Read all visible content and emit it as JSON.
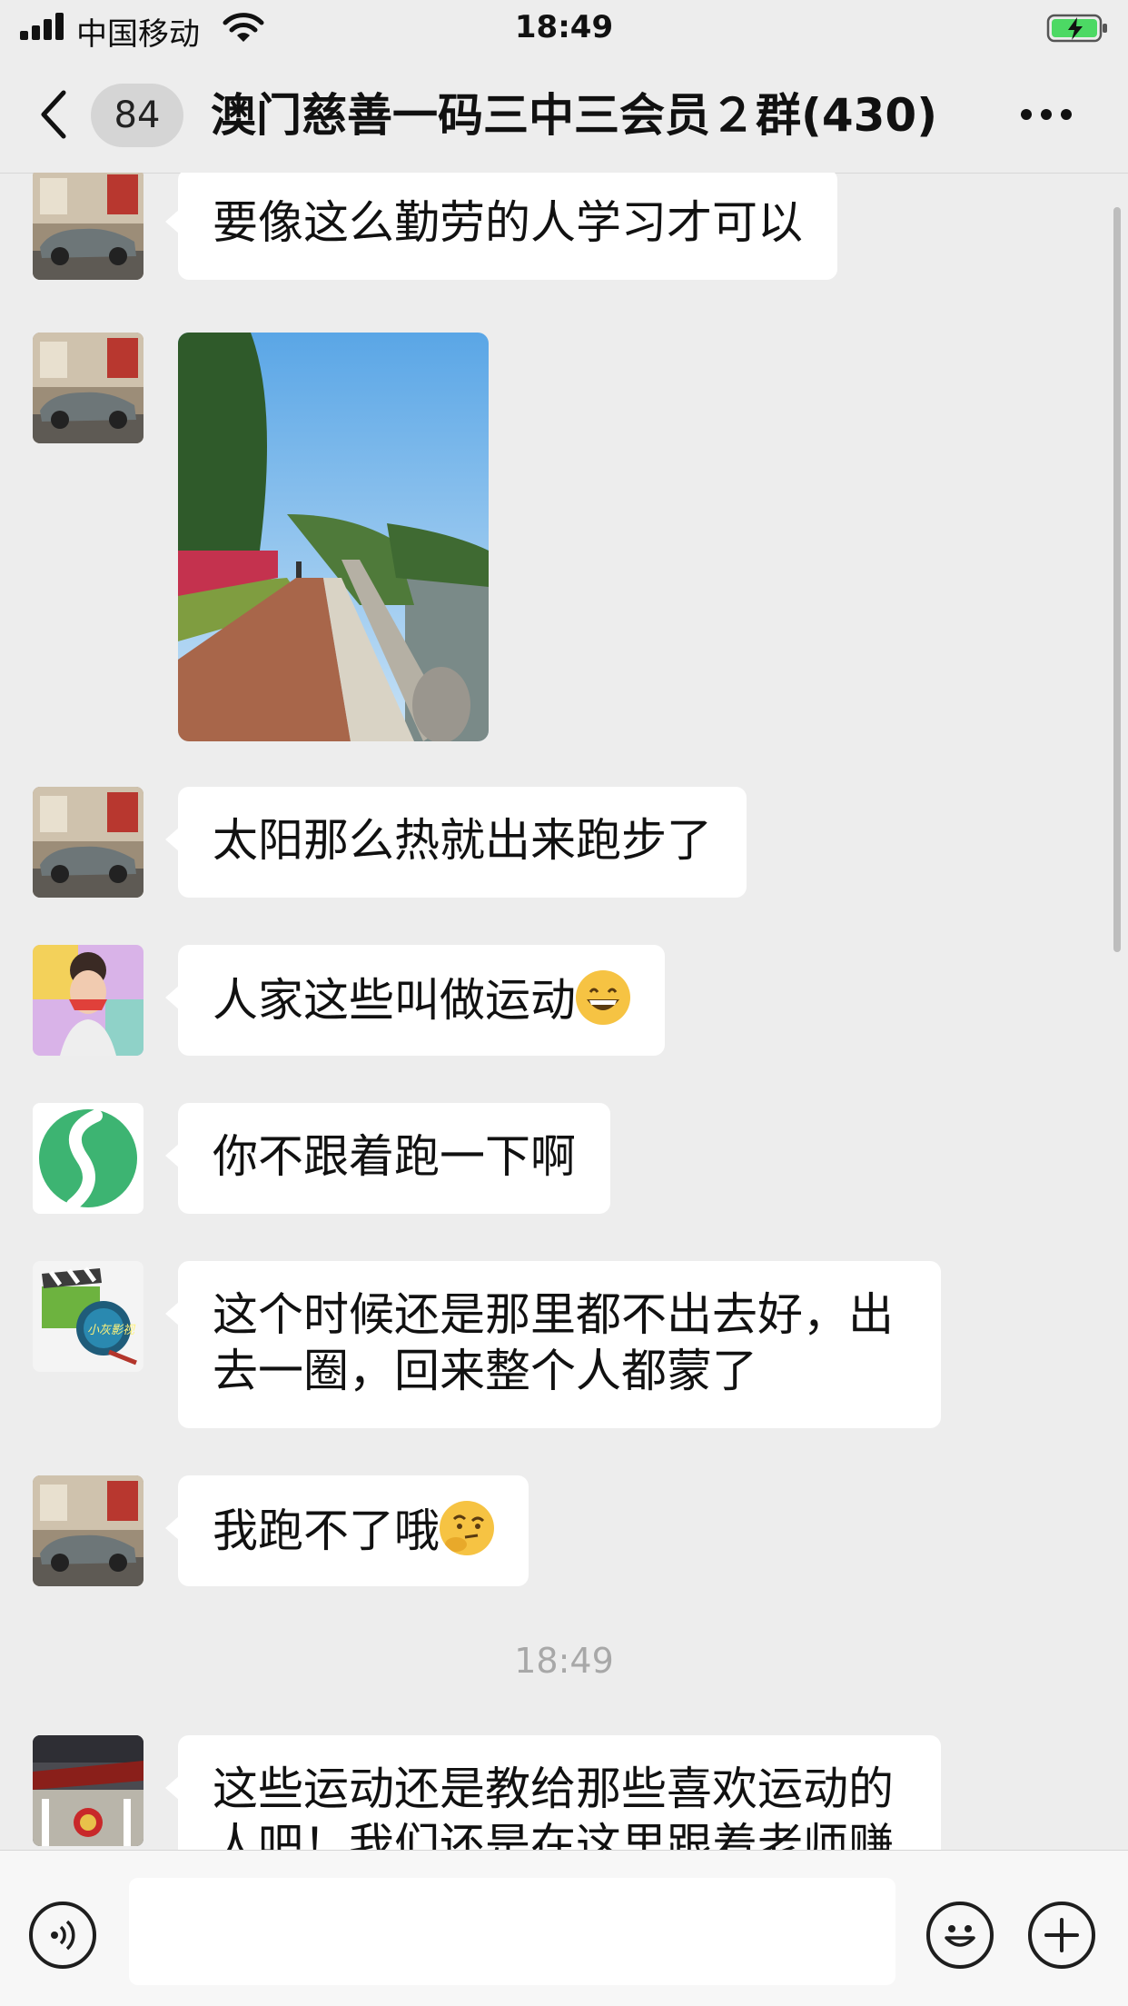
{
  "status_bar": {
    "carrier": "中国移动",
    "time": "18:49"
  },
  "nav": {
    "unread_count": "84",
    "title": "澳门慈善一码三中三会员２群(430)"
  },
  "messages": [
    {
      "type": "text",
      "avatar": "car-avatar",
      "text": "要像这么勤劳的人学习才可以"
    },
    {
      "type": "image",
      "avatar": "car-avatar"
    },
    {
      "type": "text",
      "avatar": "car-avatar",
      "text": "太阳那么热就出来跑步了"
    },
    {
      "type": "text",
      "avatar": "girl-avatar",
      "text": "人家这些叫做运动",
      "emoji": "grinning-sweat-emoji"
    },
    {
      "type": "text",
      "avatar": "green-logo-avatar",
      "text": "你不跟着跑一下啊"
    },
    {
      "type": "text",
      "avatar": "film-avatar",
      "avatar_caption": "小灰影视",
      "text": "这个时候还是那里都不出去好，出去一圈，回来整个人都蒙了"
    },
    {
      "type": "text",
      "avatar": "car-avatar",
      "text": "我跑不了哦",
      "emoji": "thinking-face-emoji"
    },
    {
      "type": "time",
      "text": "18:49"
    },
    {
      "type": "text",
      "avatar": "building-avatar",
      "text": "这些运动还是教给那些喜欢运动的人吧！我们还是在这里跟着老师赚"
    }
  ],
  "input_bar": {
    "value": "",
    "placeholder": ""
  },
  "colors": {
    "background": "#ededed",
    "bubble": "#ffffff",
    "battery_charging": "#4cd964",
    "timestamp": "#a8a8a8"
  }
}
